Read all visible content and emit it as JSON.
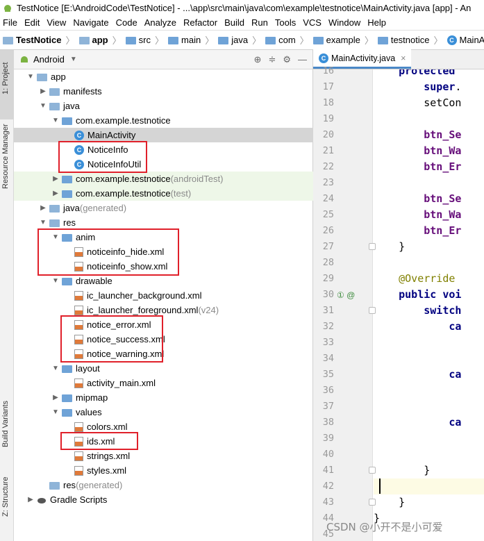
{
  "title": "TestNotice [E:\\AndroidCode\\TestNotice] - ...\\app\\src\\main\\java\\com\\example\\testnotice\\MainActivity.java [app] - An",
  "menu": [
    "File",
    "Edit",
    "View",
    "Navigate",
    "Code",
    "Analyze",
    "Refactor",
    "Build",
    "Run",
    "Tools",
    "VCS",
    "Window",
    "Help"
  ],
  "breadcrumbs": [
    "TestNotice",
    "app",
    "src",
    "main",
    "java",
    "com",
    "example",
    "testnotice",
    "MainActivity"
  ],
  "side_tabs": [
    "1: Project",
    "Resource Manager",
    "Build Variants",
    "Z: Structure"
  ],
  "project": {
    "view": "Android",
    "rows": [
      {
        "label": "app",
        "suffix": "",
        "depth": 0,
        "arrow": "▼",
        "icon": "folder"
      },
      {
        "label": "manifests",
        "suffix": "",
        "depth": 1,
        "arrow": "▶",
        "icon": "folder"
      },
      {
        "label": "java",
        "suffix": "",
        "depth": 1,
        "arrow": "▼",
        "icon": "folder"
      },
      {
        "label": "com.example.testnotice",
        "suffix": "",
        "depth": 2,
        "arrow": "▼",
        "icon": "folder"
      },
      {
        "label": "MainActivity",
        "suffix": "",
        "depth": 3,
        "arrow": "",
        "icon": "class"
      },
      {
        "label": "NoticeInfo",
        "suffix": "",
        "depth": 3,
        "arrow": "",
        "icon": "class"
      },
      {
        "label": "NoticeInfoUtil",
        "suffix": "",
        "depth": 3,
        "arrow": "",
        "icon": "class"
      },
      {
        "label": "com.example.testnotice",
        "suffix": " (androidTest)",
        "depth": 2,
        "arrow": "▶",
        "icon": "folder"
      },
      {
        "label": "com.example.testnotice",
        "suffix": " (test)",
        "depth": 2,
        "arrow": "▶",
        "icon": "folder"
      },
      {
        "label": "java",
        "suffix": " (generated)",
        "depth": 1,
        "arrow": "▶",
        "icon": "folder"
      },
      {
        "label": "res",
        "suffix": "",
        "depth": 1,
        "arrow": "▼",
        "icon": "folder"
      },
      {
        "label": "anim",
        "suffix": "",
        "depth": 2,
        "arrow": "▼",
        "icon": "folder"
      },
      {
        "label": "noticeinfo_hide.xml",
        "suffix": "",
        "depth": 3,
        "arrow": "",
        "icon": "xml"
      },
      {
        "label": "noticeinfo_show.xml",
        "suffix": "",
        "depth": 3,
        "arrow": "",
        "icon": "xml"
      },
      {
        "label": "drawable",
        "suffix": "",
        "depth": 2,
        "arrow": "▼",
        "icon": "folder"
      },
      {
        "label": "ic_launcher_background.xml",
        "suffix": "",
        "depth": 3,
        "arrow": "",
        "icon": "xml"
      },
      {
        "label": "ic_launcher_foreground.xml",
        "suffix": " (v24)",
        "depth": 3,
        "arrow": "",
        "icon": "xml"
      },
      {
        "label": "notice_error.xml",
        "suffix": "",
        "depth": 3,
        "arrow": "",
        "icon": "xml"
      },
      {
        "label": "notice_success.xml",
        "suffix": "",
        "depth": 3,
        "arrow": "",
        "icon": "xml"
      },
      {
        "label": "notice_warning.xml",
        "suffix": "",
        "depth": 3,
        "arrow": "",
        "icon": "xml"
      },
      {
        "label": "layout",
        "suffix": "",
        "depth": 2,
        "arrow": "▼",
        "icon": "folder"
      },
      {
        "label": "activity_main.xml",
        "suffix": "",
        "depth": 3,
        "arrow": "",
        "icon": "xml"
      },
      {
        "label": "mipmap",
        "suffix": "",
        "depth": 2,
        "arrow": "▶",
        "icon": "folder"
      },
      {
        "label": "values",
        "suffix": "",
        "depth": 2,
        "arrow": "▼",
        "icon": "folder"
      },
      {
        "label": "colors.xml",
        "suffix": "",
        "depth": 3,
        "arrow": "",
        "icon": "xml"
      },
      {
        "label": "ids.xml",
        "suffix": "",
        "depth": 3,
        "arrow": "",
        "icon": "xml"
      },
      {
        "label": "strings.xml",
        "suffix": "",
        "depth": 3,
        "arrow": "",
        "icon": "xml"
      },
      {
        "label": "styles.xml",
        "suffix": "",
        "depth": 3,
        "arrow": "",
        "icon": "xml"
      },
      {
        "label": "res",
        "suffix": " (generated)",
        "depth": 1,
        "arrow": "",
        "icon": "folder"
      },
      {
        "label": "Gradle Scripts",
        "suffix": "",
        "depth": 0,
        "arrow": "▶",
        "icon": "gradle"
      }
    ],
    "selected_index": 4
  },
  "editor": {
    "tab": "MainActivity.java",
    "lines": [
      {
        "n": "16",
        "code": "    protected "
      },
      {
        "n": "17",
        "code": "        super."
      },
      {
        "n": "18",
        "code": "        setCon"
      },
      {
        "n": "19",
        "code": ""
      },
      {
        "n": "20",
        "code": "        btn_Se"
      },
      {
        "n": "21",
        "code": "        btn_Wa"
      },
      {
        "n": "22",
        "code": "        btn_Er"
      },
      {
        "n": "23",
        "code": ""
      },
      {
        "n": "24",
        "code": "        btn_Se"
      },
      {
        "n": "25",
        "code": "        btn_Wa"
      },
      {
        "n": "26",
        "code": "        btn_Er"
      },
      {
        "n": "27",
        "code": "    }"
      },
      {
        "n": "28",
        "code": ""
      },
      {
        "n": "29",
        "code": "    @Override"
      },
      {
        "n": "30",
        "code": "    public voi"
      },
      {
        "n": "31",
        "code": "        switch"
      },
      {
        "n": "32",
        "code": "            ca"
      },
      {
        "n": "33",
        "code": ""
      },
      {
        "n": "34",
        "code": ""
      },
      {
        "n": "35",
        "code": "            ca"
      },
      {
        "n": "36",
        "code": ""
      },
      {
        "n": "37",
        "code": ""
      },
      {
        "n": "38",
        "code": "            ca"
      },
      {
        "n": "39",
        "code": ""
      },
      {
        "n": "40",
        "code": ""
      },
      {
        "n": "41",
        "code": "        }"
      },
      {
        "n": "42",
        "code": ""
      },
      {
        "n": "43",
        "code": "    }"
      },
      {
        "n": "44",
        "code": "}"
      },
      {
        "n": "45",
        "code": ""
      }
    ],
    "current_line": "42"
  },
  "watermark": "CSDN @小开不是小可爱"
}
